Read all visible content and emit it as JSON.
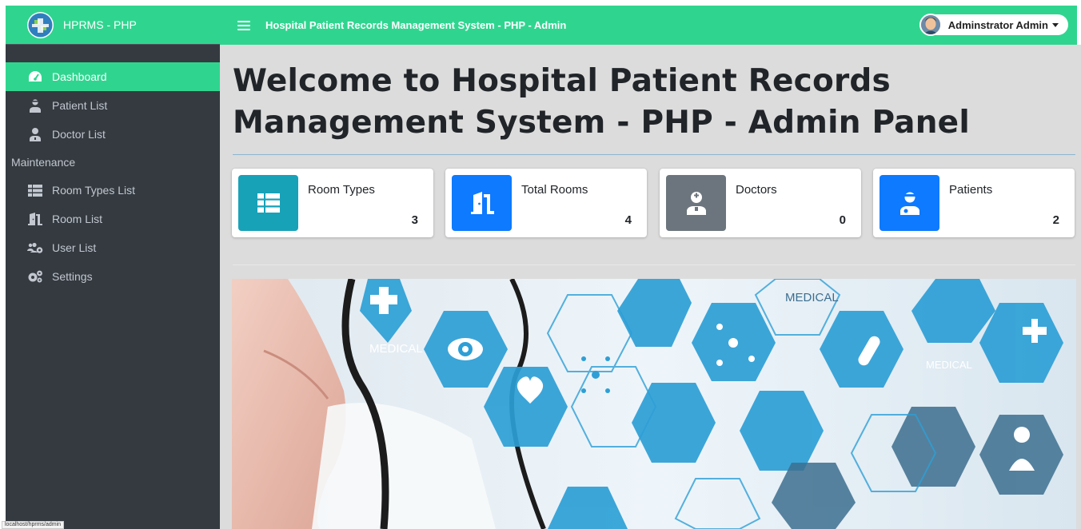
{
  "brand": {
    "name": "HPRMS - PHP",
    "logo_icon": "medical-logo-icon"
  },
  "header": {
    "title": "Hospital Patient Records Management System - PHP - Admin",
    "menu_icon": "hamburger-icon"
  },
  "user": {
    "name": "Adminstrator Admin",
    "avatar_icon": "user-avatar"
  },
  "sidebar": {
    "items": [
      {
        "label": "Dashboard",
        "icon": "tachometer-icon",
        "active": true
      },
      {
        "label": "Patient List",
        "icon": "user-injured-icon"
      },
      {
        "label": "Doctor List",
        "icon": "user-md-icon"
      }
    ],
    "section_header": "Maintenance",
    "maintenance_items": [
      {
        "label": "Room Types List",
        "icon": "th-list-icon"
      },
      {
        "label": "Room List",
        "icon": "door-open-icon"
      },
      {
        "label": "User List",
        "icon": "users-cog-icon"
      },
      {
        "label": "Settings",
        "icon": "cogs-icon"
      }
    ]
  },
  "page": {
    "title": "Welcome to Hospital Patient Records Management System - PHP - Admin Panel"
  },
  "cards": [
    {
      "label": "Room Types",
      "value": "3",
      "color": "#17a2b8",
      "icon": "th-list-icon"
    },
    {
      "label": "Total Rooms",
      "value": "4",
      "color": "#0d7aff",
      "icon": "door-open-icon"
    },
    {
      "label": "Doctors",
      "value": "0",
      "color": "#6c757d",
      "icon": "user-md-icon"
    },
    {
      "label": "Patients",
      "value": "2",
      "color": "#0d7aff",
      "icon": "user-injured-icon"
    }
  ],
  "banner": {
    "texts": [
      "MEDICAL",
      "MEDICAL",
      "MEDICAL"
    ]
  },
  "status": {
    "url": "localhost/hprms/admin"
  },
  "colors": {
    "accent": "#2fd58f",
    "sidebar": "#343a40",
    "content_bg": "#dcdcdc"
  }
}
